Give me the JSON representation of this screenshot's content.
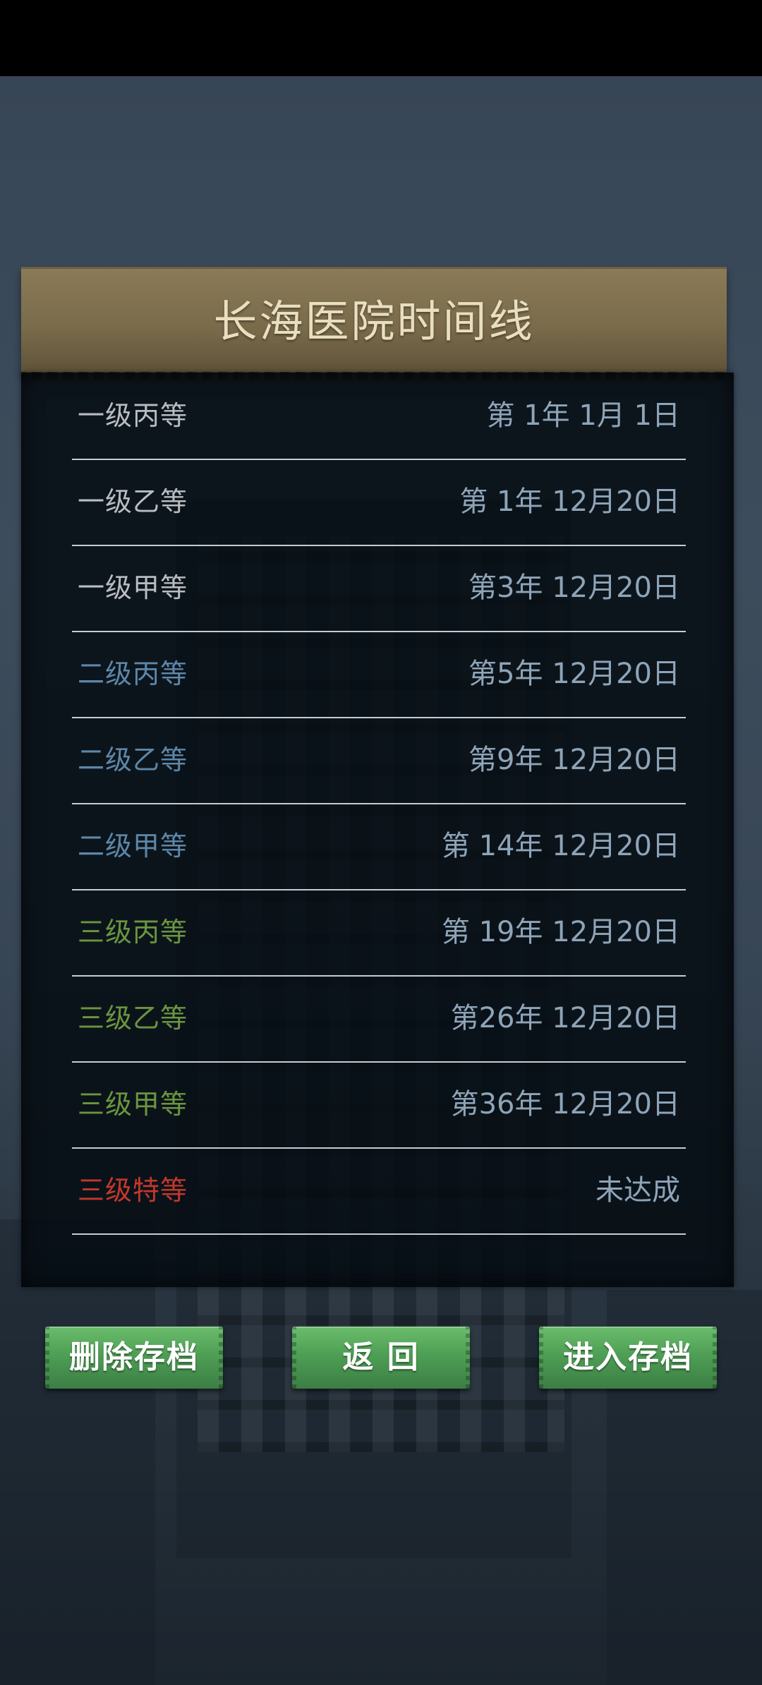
{
  "panel": {
    "title": "长海医院时间线"
  },
  "rows": [
    {
      "level": "一级丙等",
      "date": "第 1年 1月 1日",
      "color": "#b9bdc1"
    },
    {
      "level": "一级乙等",
      "date": "第 1年 12月20日",
      "color": "#b9bdc1"
    },
    {
      "level": "一级甲等",
      "date": "第3年 12月20日",
      "color": "#b9bdc1"
    },
    {
      "level": "二级丙等",
      "date": "第5年 12月20日",
      "color": "#5d87a9"
    },
    {
      "level": "二级乙等",
      "date": "第9年 12月20日",
      "color": "#5d87a9"
    },
    {
      "level": "二级甲等",
      "date": "第 14年 12月20日",
      "color": "#5d87a9"
    },
    {
      "level": "三级丙等",
      "date": "第 19年 12月20日",
      "color": "#6b953f"
    },
    {
      "level": "三级乙等",
      "date": "第26年 12月20日",
      "color": "#6b953f"
    },
    {
      "level": "三级甲等",
      "date": "第36年 12月20日",
      "color": "#6b953f"
    },
    {
      "level": "三级特等",
      "date": "未达成",
      "color": "#c2382b"
    }
  ],
  "buttons": {
    "delete_label": "删除存档",
    "back_label": "返  回",
    "enter_label": "进入存档"
  }
}
